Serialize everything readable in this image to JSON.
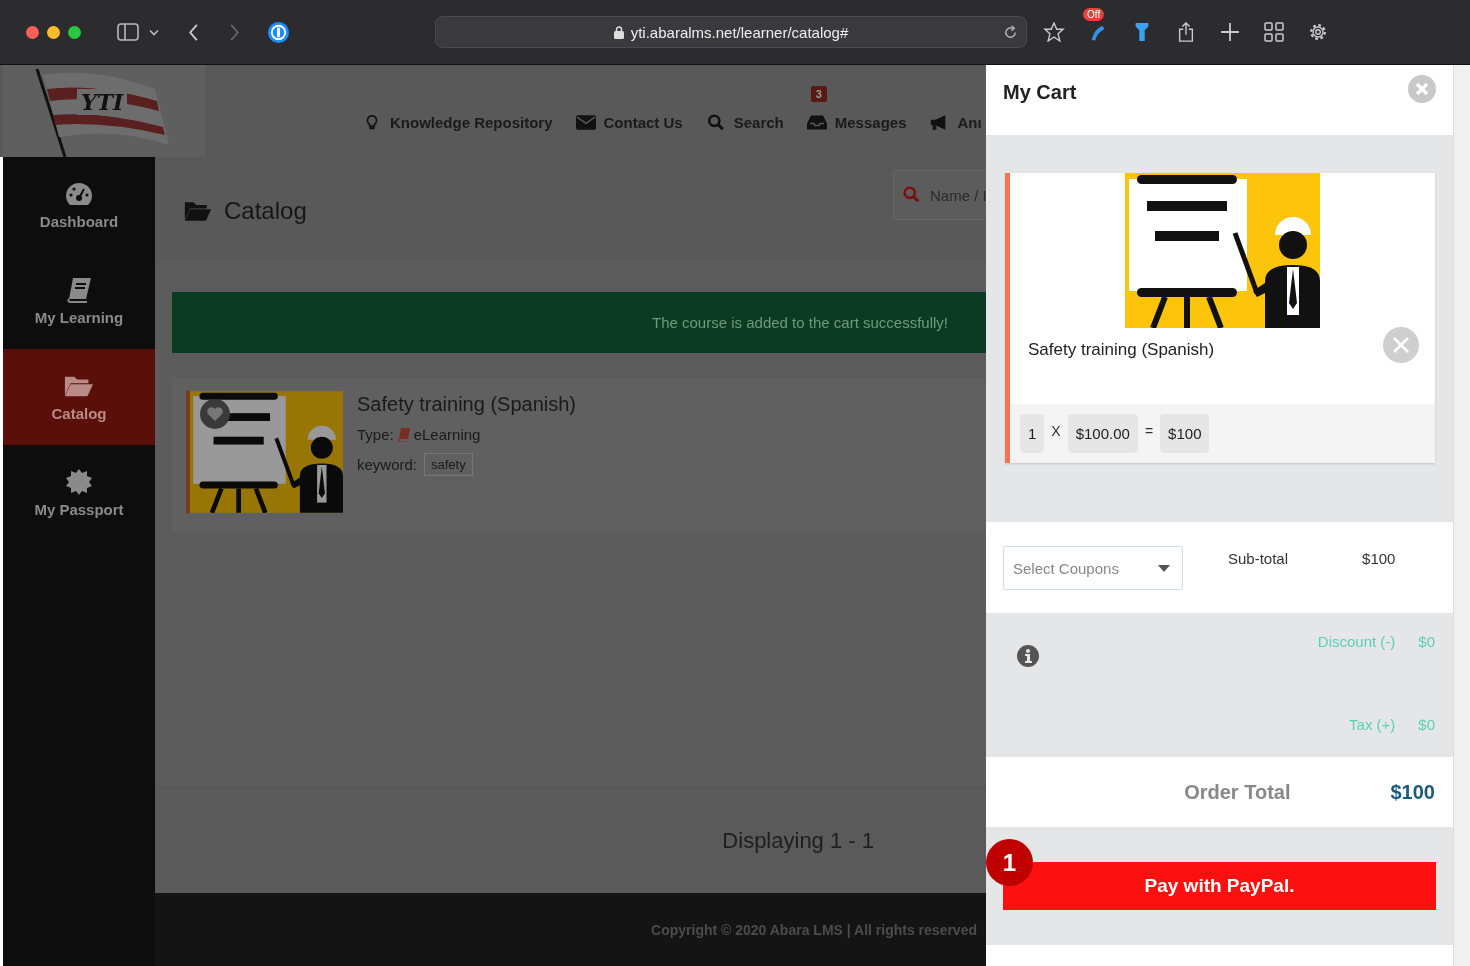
{
  "browser": {
    "url": "yti.abaralms.net/learner/catalog#",
    "extension_badge": "Off"
  },
  "header": {
    "logo_text": "YTI",
    "nav": [
      {
        "label": "Knowledge Repository",
        "kind": "bulb"
      },
      {
        "label": "Contact Us",
        "kind": "mail"
      },
      {
        "label": "Search",
        "kind": "search"
      },
      {
        "label": "Messages",
        "kind": "inbox",
        "badge": "3"
      },
      {
        "label": "Anı",
        "kind": "bullhorn"
      }
    ]
  },
  "sidebar": {
    "items": [
      {
        "label": "Dashboard",
        "kind": "dashboard",
        "selected": false
      },
      {
        "label": "My Learning",
        "kind": "book",
        "selected": false
      },
      {
        "label": "Catalog",
        "kind": "folder",
        "selected": true
      },
      {
        "label": "My Passport",
        "kind": "badge",
        "selected": false
      }
    ]
  },
  "catalog": {
    "title": "Catalog",
    "search_placeholder": "Name / I",
    "alert": "The course is added to the cart successfully!",
    "course": {
      "title": "Safety training (Spanish)",
      "type_label": "Type:",
      "type": "eLearning",
      "keyword_label": "keyword:",
      "keyword": "safety"
    },
    "pagination": "Displaying 1 - 1"
  },
  "footer": {
    "copyright": "Copyright © 2020 Abara LMS | All rights reserved"
  },
  "cart": {
    "title": "My Cart",
    "items": [
      {
        "title": "Safety training (Spanish)",
        "quantity": "1",
        "times": "X",
        "price": "$100.00",
        "equals": "=",
        "total": "$100"
      }
    ],
    "coupon_placeholder": "Select Coupons",
    "subtotal_label": "Sub-total",
    "subtotal": "$100",
    "discount_label": "Discount (-)",
    "discount": "$0",
    "tax_label": "Tax (+)",
    "tax": "$0",
    "order_total_label": "Order Total",
    "order_total": "$100",
    "pay_button": "Pay with PayPal.",
    "step_badge": "1"
  }
}
